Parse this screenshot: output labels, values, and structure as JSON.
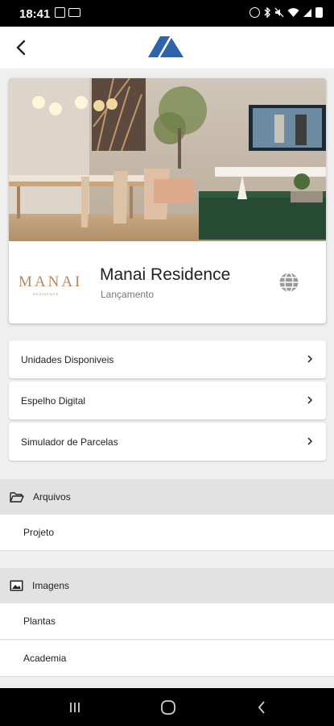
{
  "status_bar": {
    "time": "18:41",
    "left_icons": [
      "image-icon",
      "laptop-icon"
    ],
    "right_icons": [
      "alarm-icon",
      "bluetooth-icon",
      "mute-icon",
      "wifi-icon",
      "signal-icon",
      "battery-icon"
    ]
  },
  "app_bar": {
    "back_icon": "chevron-left-icon",
    "logo_icon": "mountain-logo-icon",
    "logo_color": "#2f64a8"
  },
  "property": {
    "brand_text": "MANAI",
    "brand_subtext": "RESIDENCE",
    "brand_color": "#b38a66",
    "name": "Manai Residence",
    "status": "Lançamento",
    "globe_icon": "globe-icon"
  },
  "menu": [
    {
      "label": "Unidades Disponiveis",
      "icon": "chevron-right-icon"
    },
    {
      "label": "Espelho Digital",
      "icon": "chevron-right-icon"
    },
    {
      "label": "Simulador de Parcelas",
      "icon": "chevron-right-icon"
    }
  ],
  "sections": [
    {
      "title": "Arquivos",
      "icon": "folder-icon",
      "items": [
        {
          "label": "Projeto"
        }
      ]
    },
    {
      "title": "Imagens",
      "icon": "image-icon",
      "items": [
        {
          "label": "Plantas"
        },
        {
          "label": "Academia"
        }
      ]
    }
  ],
  "nav_bar": [
    "recents-icon",
    "home-icon",
    "back-icon"
  ]
}
